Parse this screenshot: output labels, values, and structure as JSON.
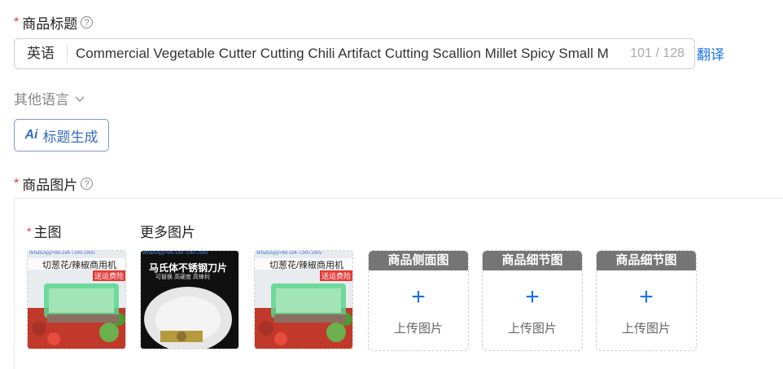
{
  "title_section": {
    "required_mark": "*",
    "label": "商品标题",
    "help_glyph": "?",
    "lang_tag": "英语",
    "title_value": "Commercial Vegetable Cutter Cutting Chili Artifact Cutting Scallion Millet Spicy Small M",
    "counter": "101 / 128",
    "translate_label": "翻译",
    "other_lang_label": "其他语言",
    "ai_button": {
      "icon_text": "Ai",
      "label": "标题生成"
    }
  },
  "image_section": {
    "required_mark": "*",
    "label": "商品图片",
    "help_glyph": "?",
    "main_label": "主图",
    "more_label": "更多图片",
    "thumbnails": [
      {
        "banner": "切葱花/辣椒商用机",
        "badge": "送运费险",
        "watermark": "WhatsApp+86-184-7240-2905"
      },
      {
        "banner": "马氏体不锈钢刀片",
        "sub": "可替换  高硬度  高锋利",
        "watermark": "WhatsApp+86-184-7240-2905"
      },
      {
        "banner": "切葱花/辣椒商用机",
        "badge": "送运费险",
        "watermark": "WhatsApp+86-184-7240-2905"
      }
    ],
    "upload_slots": [
      {
        "header": "商品侧面图",
        "plus": "+",
        "text": "上传图片"
      },
      {
        "header": "商品细节图",
        "plus": "+",
        "text": "上传图片"
      },
      {
        "header": "商品细节图",
        "plus": "+",
        "text": "上传图片"
      }
    ]
  },
  "colors": {
    "accent": "#1a73e8",
    "required": "#e4393c",
    "upload_header": "#757575"
  }
}
